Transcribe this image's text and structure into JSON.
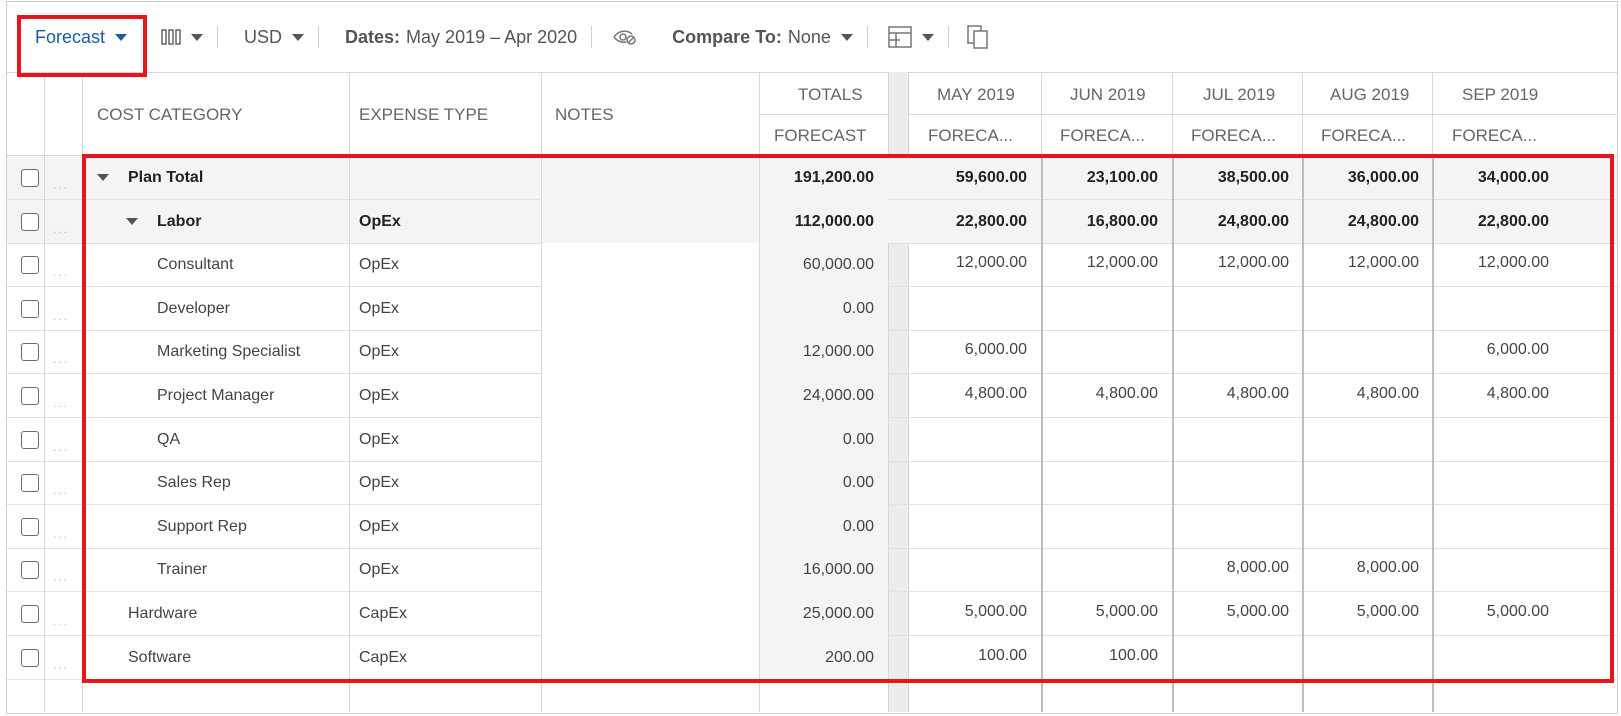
{
  "toolbar": {
    "view_label": "Forecast",
    "currency": "USD",
    "dates_label": "Dates:",
    "dates_value": "May 2019 – Apr 2020",
    "compare_label": "Compare To:",
    "compare_value": "None"
  },
  "columns": {
    "cost_category": "COST CATEGORY",
    "expense_type": "EXPENSE TYPE",
    "notes": "NOTES",
    "totals": "TOTALS",
    "totals_sub": "FORECAST",
    "months": [
      {
        "label": "MAY 2019",
        "sub": "FORECA..."
      },
      {
        "label": "JUN 2019",
        "sub": "FORECA..."
      },
      {
        "label": "JUL 2019",
        "sub": "FORECA..."
      },
      {
        "label": "AUG 2019",
        "sub": "FORECA..."
      },
      {
        "label": "SEP 2019",
        "sub": "FORECA..."
      }
    ]
  },
  "rows": [
    {
      "category": "Plan Total",
      "expense": "",
      "total": "191,200.00",
      "months": [
        "59,600.00",
        "23,100.00",
        "38,500.00",
        "36,000.00",
        "34,000.00"
      ]
    },
    {
      "category": "Labor",
      "expense": "OpEx",
      "total": "112,000.00",
      "months": [
        "22,800.00",
        "16,800.00",
        "24,800.00",
        "24,800.00",
        "22,800.00"
      ]
    },
    {
      "category": "Consultant",
      "expense": "OpEx",
      "total": "60,000.00",
      "months": [
        "12,000.00",
        "12,000.00",
        "12,000.00",
        "12,000.00",
        "12,000.00"
      ]
    },
    {
      "category": "Developer",
      "expense": "OpEx",
      "total": "0.00",
      "months": [
        "",
        "",
        "",
        "",
        ""
      ]
    },
    {
      "category": "Marketing Specialist",
      "expense": "OpEx",
      "total": "12,000.00",
      "months": [
        "6,000.00",
        "",
        "",
        "",
        "6,000.00"
      ]
    },
    {
      "category": "Project Manager",
      "expense": "OpEx",
      "total": "24,000.00",
      "months": [
        "4,800.00",
        "4,800.00",
        "4,800.00",
        "4,800.00",
        "4,800.00"
      ]
    },
    {
      "category": "QA",
      "expense": "OpEx",
      "total": "0.00",
      "months": [
        "",
        "",
        "",
        "",
        ""
      ]
    },
    {
      "category": "Sales Rep",
      "expense": "OpEx",
      "total": "0.00",
      "months": [
        "",
        "",
        "",
        "",
        ""
      ]
    },
    {
      "category": "Support Rep",
      "expense": "OpEx",
      "total": "0.00",
      "months": [
        "",
        "",
        "",
        "",
        ""
      ]
    },
    {
      "category": "Trainer",
      "expense": "OpEx",
      "total": "16,000.00",
      "months": [
        "",
        "",
        "8,000.00",
        "8,000.00",
        ""
      ]
    },
    {
      "category": "Hardware",
      "expense": "CapEx",
      "total": "25,000.00",
      "months": [
        "5,000.00",
        "5,000.00",
        "5,000.00",
        "5,000.00",
        "5,000.00"
      ]
    },
    {
      "category": "Software",
      "expense": "CapEx",
      "total": "200.00",
      "months": [
        "100.00",
        "100.00",
        "",
        "",
        ""
      ]
    }
  ]
}
